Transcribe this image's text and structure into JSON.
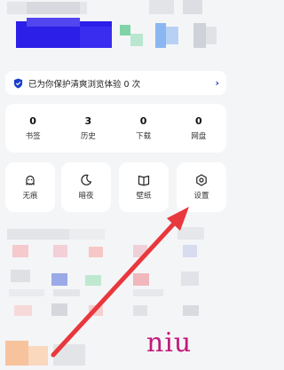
{
  "banner": {
    "text": "已为你保护清爽浏览体验 0 次",
    "chevron": "›",
    "icon": "shield-icon"
  },
  "stats": [
    {
      "num": "0",
      "label": "书签"
    },
    {
      "num": "3",
      "label": "历史"
    },
    {
      "num": "0",
      "label": "下载"
    },
    {
      "num": "0",
      "label": "网盘"
    }
  ],
  "tools": [
    {
      "label": "无痕",
      "icon": "incognito-icon"
    },
    {
      "label": "暗夜",
      "icon": "moon-icon"
    },
    {
      "label": "壁纸",
      "icon": "book-icon"
    },
    {
      "label": "设置",
      "icon": "gear-icon"
    }
  ],
  "watermark": "niu",
  "colors": {
    "accent": "#1a3fcc",
    "arrow": "#e8383d",
    "watermark": "#c2187a"
  }
}
